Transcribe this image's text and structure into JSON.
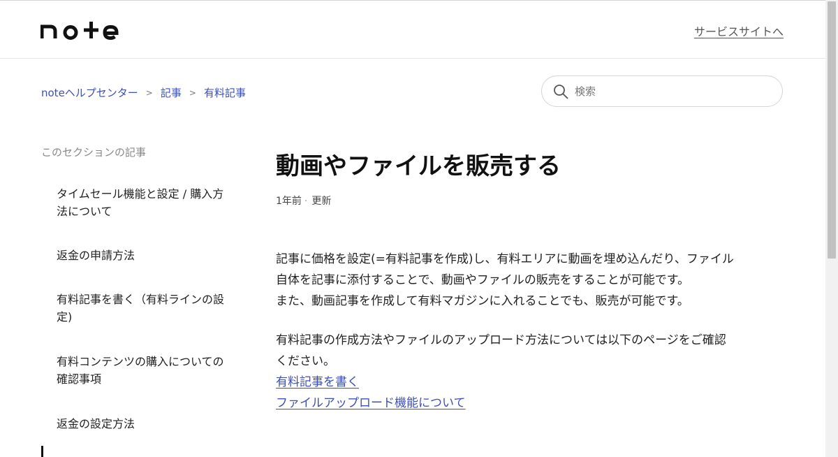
{
  "header": {
    "logo_text": "note",
    "service_link": "サービスサイトへ"
  },
  "breadcrumb": {
    "items": [
      "noteヘルプセンター",
      "記事",
      "有料記事"
    ],
    "separator": ">"
  },
  "search": {
    "placeholder": "検索",
    "value": ""
  },
  "sidebar": {
    "title": "このセクションの記事",
    "items": [
      {
        "label": "タイムセール機能と設定 / 購入方法について"
      },
      {
        "label": "返金の申請方法"
      },
      {
        "label": "有料記事を書く（有料ラインの設定)"
      },
      {
        "label": "有料コンテンツの購入についての確認事項"
      },
      {
        "label": "返金の設定方法"
      }
    ]
  },
  "article": {
    "title": "動画やファイルを販売する",
    "meta_time": "1年前",
    "meta_dot": "·",
    "meta_updated": "更新",
    "para1_line1": "記事に価格を設定(=有料記事を作成)し、有料エリアに動画を埋め込んだり、ファイル",
    "para1_line2": "自体を記事に添付することで、動画やファイルの販売をすることが可能です。",
    "para1_line3": "また、動画記事を作成して有料マガジンに入れることでも、販売が可能です。",
    "para2_line1": "有料記事の作成方法やファイルのアップロード方法については以下のページをご確認",
    "para2_line2": "ください。",
    "link1": "有料記事を書く",
    "link2": "ファイルアップロード機能について"
  },
  "colors": {
    "accent_link": "#3d4fb5",
    "text": "#222222",
    "muted": "#888888"
  }
}
